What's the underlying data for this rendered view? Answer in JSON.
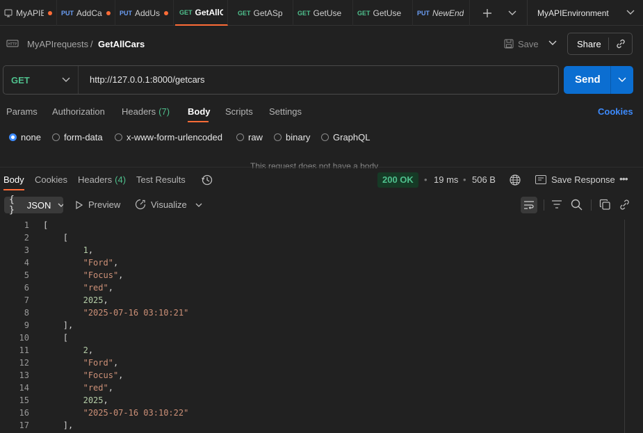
{
  "tabs": [
    {
      "method": "",
      "label": "MyAPIE",
      "dirty": true,
      "active": false,
      "italic": false
    },
    {
      "method": "PUT",
      "label": "AddCa",
      "dirty": true,
      "active": false,
      "italic": false
    },
    {
      "method": "PUT",
      "label": "AddUs",
      "dirty": true,
      "active": false,
      "italic": false
    },
    {
      "method": "GET",
      "label": "GetAllC",
      "dirty": false,
      "active": true,
      "italic": false
    },
    {
      "method": "GET",
      "label": "GetASp",
      "dirty": false,
      "active": false,
      "italic": false
    },
    {
      "method": "GET",
      "label": "GetUse",
      "dirty": false,
      "active": false,
      "italic": false
    },
    {
      "method": "GET",
      "label": "GetUse",
      "dirty": false,
      "active": false,
      "italic": false
    },
    {
      "method": "PUT",
      "label": "NewEnd",
      "dirty": false,
      "active": false,
      "italic": true
    }
  ],
  "environment": "MyAPIEnvironment",
  "breadcrumb": {
    "collection": "MyAPIrequests",
    "separator": "/",
    "request": "GetAllCars"
  },
  "save_label": "Save",
  "share_label": "Share",
  "request": {
    "method": "GET",
    "url": "http://127.0.0.1:8000/getcars",
    "send_label": "Send"
  },
  "request_tabs": [
    {
      "label": "Params",
      "count": ""
    },
    {
      "label": "Authorization",
      "count": ""
    },
    {
      "label": "Headers",
      "count": "(7)"
    },
    {
      "label": "Body",
      "count": ""
    },
    {
      "label": "Scripts",
      "count": ""
    },
    {
      "label": "Settings",
      "count": ""
    }
  ],
  "cookies_link": "Cookies",
  "body_types": [
    "none",
    "form-data",
    "x-www-form-urlencoded",
    "raw",
    "binary",
    "GraphQL"
  ],
  "body_selected": "none",
  "no_body_msg": "This request does not have a body",
  "response_tabs": [
    {
      "label": "Body",
      "count": ""
    },
    {
      "label": "Cookies",
      "count": ""
    },
    {
      "label": "Headers",
      "count": "(4)"
    },
    {
      "label": "Test Results",
      "count": ""
    }
  ],
  "response_meta": {
    "status": "200 OK",
    "time": "19 ms",
    "size": "506 B",
    "save_response": "Save Response"
  },
  "format_label": "JSON",
  "preview_label": "Preview",
  "visualize_label": "Visualize",
  "code_lines": [
    {
      "n": "1",
      "text": "[",
      "kind": "p",
      "indent": 0
    },
    {
      "n": "2",
      "text": "[",
      "kind": "p",
      "indent": 1
    },
    {
      "n": "3",
      "text": "1",
      "kind": "num",
      "indent": 2,
      "comma": true
    },
    {
      "n": "4",
      "text": "\"Ford\"",
      "kind": "str",
      "indent": 2,
      "comma": true
    },
    {
      "n": "5",
      "text": "\"Focus\"",
      "kind": "str",
      "indent": 2,
      "comma": true
    },
    {
      "n": "6",
      "text": "\"red\"",
      "kind": "str",
      "indent": 2,
      "comma": true
    },
    {
      "n": "7",
      "text": "2025",
      "kind": "num",
      "indent": 2,
      "comma": true
    },
    {
      "n": "8",
      "text": "\"2025-07-16 03:10:21\"",
      "kind": "str",
      "indent": 2,
      "comma": false
    },
    {
      "n": "9",
      "text": "],",
      "kind": "p",
      "indent": 1
    },
    {
      "n": "10",
      "text": "[",
      "kind": "p",
      "indent": 1
    },
    {
      "n": "11",
      "text": "2",
      "kind": "num",
      "indent": 2,
      "comma": true
    },
    {
      "n": "12",
      "text": "\"Ford\"",
      "kind": "str",
      "indent": 2,
      "comma": true
    },
    {
      "n": "13",
      "text": "\"Focus\"",
      "kind": "str",
      "indent": 2,
      "comma": true
    },
    {
      "n": "14",
      "text": "\"red\"",
      "kind": "str",
      "indent": 2,
      "comma": true
    },
    {
      "n": "15",
      "text": "2025",
      "kind": "num",
      "indent": 2,
      "comma": true
    },
    {
      "n": "16",
      "text": "\"2025-07-16 03:10:22\"",
      "kind": "str",
      "indent": 2,
      "comma": false
    },
    {
      "n": "17",
      "text": "],",
      "kind": "p",
      "indent": 1
    }
  ],
  "colors": {
    "accent": "#ff6c37",
    "send": "#0b6ed1",
    "get": "#4fc08d",
    "put": "#6b9ef5",
    "link": "#3d8bfd"
  }
}
